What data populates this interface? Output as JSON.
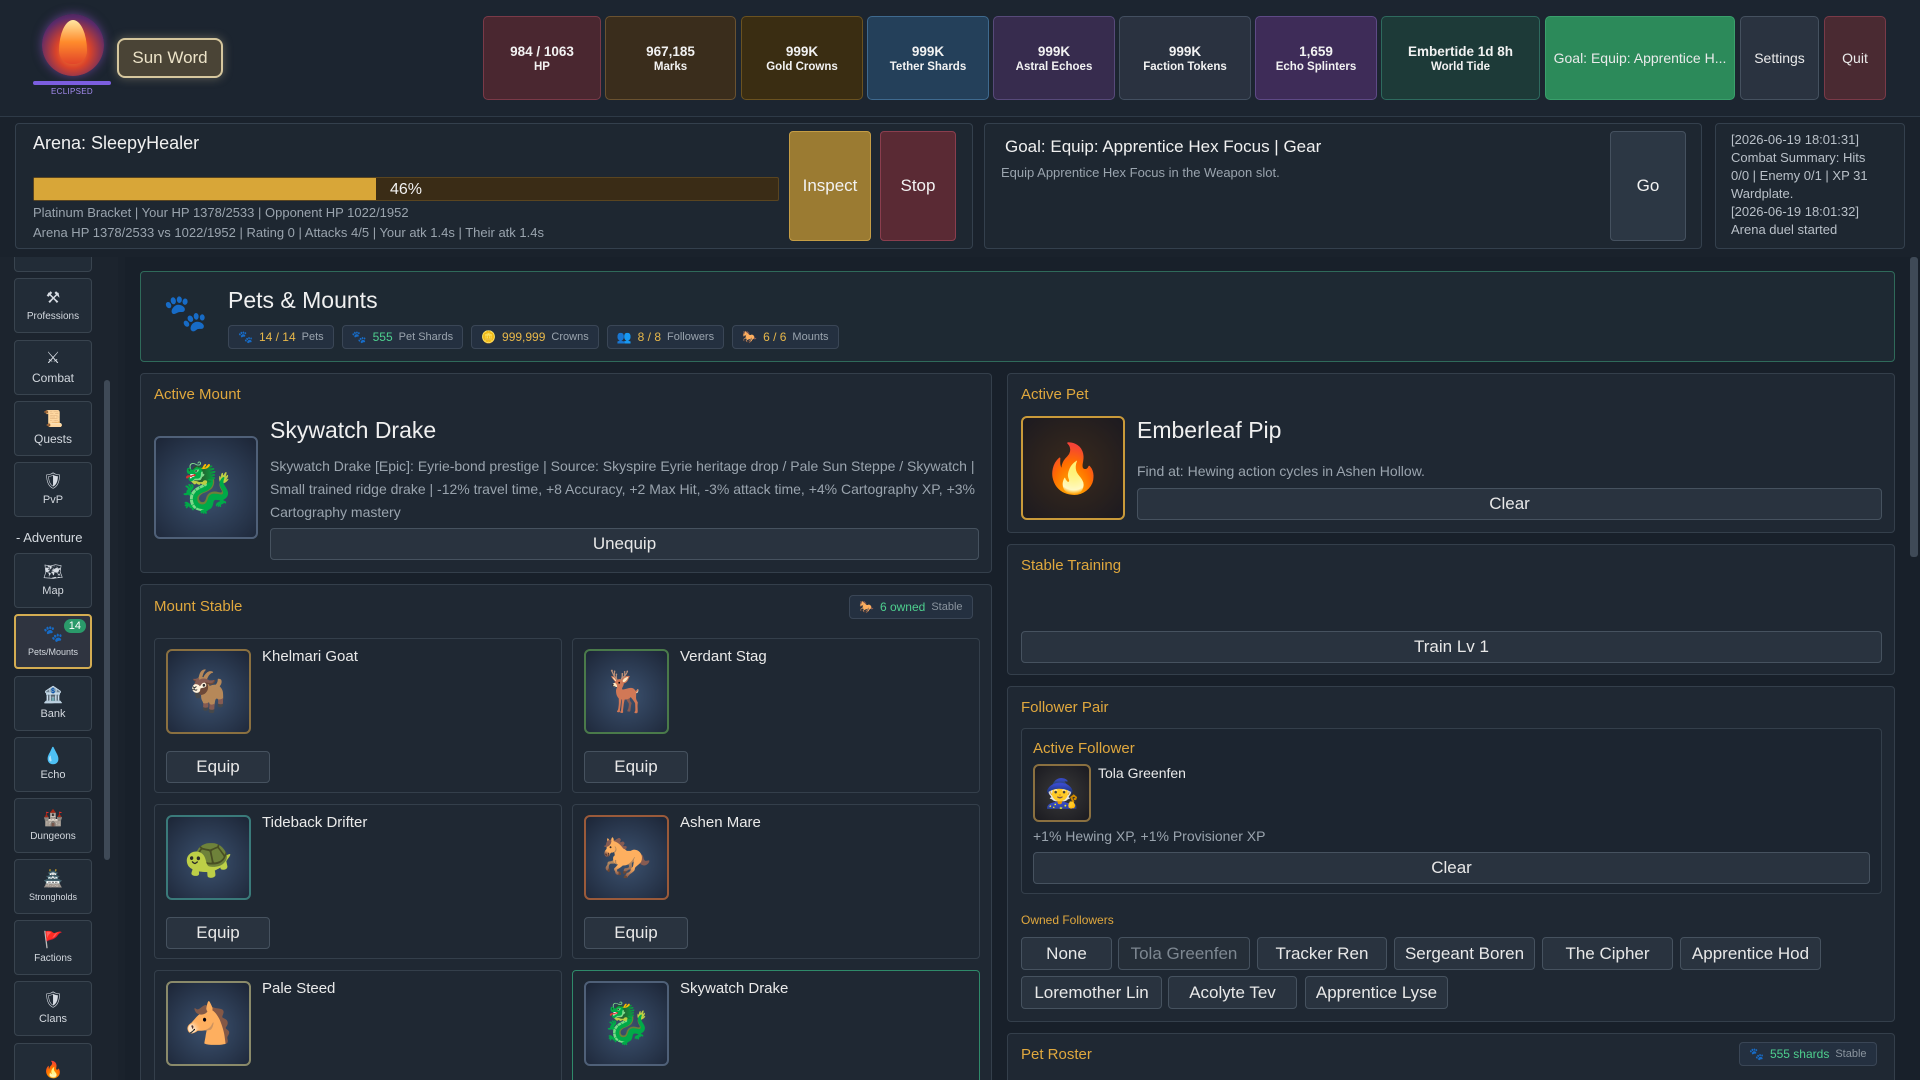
{
  "topbar": {
    "logo_caption": "ECLIPSED",
    "sun_word": "Sun Word",
    "stats": [
      {
        "value": "984 / 1063",
        "label": "HP",
        "color": "#4a2730",
        "border": "#7a3a48"
      },
      {
        "value": "967,185",
        "label": "Marks",
        "color": "#3a2d1c",
        "border": "#6a5230"
      },
      {
        "value": "999K",
        "label": "Gold Crowns",
        "color": "#3a2d12",
        "border": "#6a5220"
      },
      {
        "value": "999K",
        "label": "Tether Shards",
        "color": "#24405a",
        "border": "#3f6a8f"
      },
      {
        "value": "999K",
        "label": "Astral Echoes",
        "color": "#372c4e",
        "border": "#574a7a"
      },
      {
        "value": "999K",
        "label": "Faction Tokens",
        "color": "#2a3240",
        "border": "#434f60"
      },
      {
        "value": "1,659",
        "label": "Echo Splinters",
        "color": "#3e2c58",
        "border": "#5e4a86"
      },
      {
        "value": "Embertide 1d 8h",
        "label": "World Tide",
        "color": "#1d3a38",
        "border": "#2e6a5e"
      }
    ],
    "goal_button": "Goal: Equip: Apprentice H...",
    "settings": "Settings",
    "quit": "Quit"
  },
  "arena": {
    "title": "Arena: SleepyHealer",
    "progress_pct": 46,
    "progress_label": "46%",
    "line1": "Platinum Bracket | Your HP 1378/2533 | Opponent HP 1022/1952",
    "line2": "Arena HP 1378/2533 vs 1022/1952 | Rating 0 | Attacks 4/5 | Your atk 1.4s | Their atk 1.4s",
    "inspect": "Inspect",
    "stop": "Stop"
  },
  "goal": {
    "title": "Goal: Equip: Apprentice Hex Focus | Gear",
    "desc": "Equip Apprentice Hex Focus in the Weapon slot.",
    "go": "Go"
  },
  "log": [
    "[2026-06-19 18:01:31]",
    "Combat Summary: Hits",
    "0/0 | Enemy 0/1 | XP 31",
    "Wardplate.",
    "[2026-06-19 18:01:32]",
    "Arena duel started"
  ],
  "sidebar": {
    "items": [
      {
        "icon": "⚒",
        "label": "Professions"
      },
      {
        "icon": "⚔",
        "label": "Combat"
      },
      {
        "icon": "📜",
        "label": "Quests"
      },
      {
        "icon": "🛡",
        "label": "PvP"
      },
      {
        "icon": "🗺",
        "label": "Map"
      },
      {
        "icon": "🐾",
        "label": "Pets/Mounts",
        "badge": "14"
      },
      {
        "icon": "🏦",
        "label": "Bank"
      },
      {
        "icon": "💧",
        "label": "Echo"
      },
      {
        "icon": "🏰",
        "label": "Dungeons"
      },
      {
        "icon": "🏯",
        "label": "Strongholds"
      },
      {
        "icon": "🚩",
        "label": "Factions"
      },
      {
        "icon": "🛡",
        "label": "Clans"
      }
    ],
    "section": "- Adventure"
  },
  "page": {
    "title": "Pets & Mounts",
    "chips": [
      {
        "icon": "🐾",
        "value": "14 / 14",
        "label": "Pets"
      },
      {
        "icon": "🐾",
        "value": "555",
        "label": "Pet Shards"
      },
      {
        "icon": "🪙",
        "value": "999,999",
        "label": "Crowns"
      },
      {
        "icon": "👥",
        "value": "8 / 8",
        "label": "Followers"
      },
      {
        "icon": "🐎",
        "value": "6 / 6",
        "label": "Mounts"
      }
    ]
  },
  "active_mount": {
    "section": "Active Mount",
    "name": "Skywatch Drake",
    "desc": "Skywatch Drake [Epic]: Eyrie-bond prestige | Source: Skyspire Eyrie heritage drop / Pale Sun Steppe / Skywatch | Small trained ridge drake | -12% travel time, +8 Accuracy, +2 Max Hit, -3% attack time, +4% Cartography XP, +3% Cartography mastery",
    "unequip": "Unequip"
  },
  "stable": {
    "section": "Mount Stable",
    "owned": "6 owned",
    "owned_tag": "Stable",
    "mounts": [
      {
        "name": "Khelmari Goat",
        "button": "Equip"
      },
      {
        "name": "Verdant Stag",
        "button": "Equip"
      },
      {
        "name": "Tideback Drifter",
        "button": "Equip"
      },
      {
        "name": "Ashen Mare",
        "button": "Equip"
      },
      {
        "name": "Pale Steed"
      },
      {
        "name": "Skywatch Drake"
      }
    ]
  },
  "active_pet": {
    "section": "Active Pet",
    "name": "Emberleaf Pip",
    "find": "Find at: Hewing action cycles in Ashen Hollow.",
    "clear": "Clear"
  },
  "training": {
    "section": "Stable Training",
    "button": "Train Lv 1"
  },
  "followers": {
    "section": "Follower Pair",
    "active_label": "Active Follower",
    "active_name": "Tola Greenfen",
    "bonus": "+1% Hewing XP, +1% Provisioner XP",
    "clear": "Clear",
    "owned_label": "Owned Followers",
    "owned": [
      "None",
      "Tola Greenfen",
      "Tracker Ren",
      "Sergeant Boren",
      "The Cipher",
      "Apprentice Hod",
      "Loremother Lin",
      "Acolyte Tev",
      "Apprentice Lyse"
    ]
  },
  "roster": {
    "section": "Pet Roster",
    "shards": "555 shards",
    "tag": "Stable"
  }
}
